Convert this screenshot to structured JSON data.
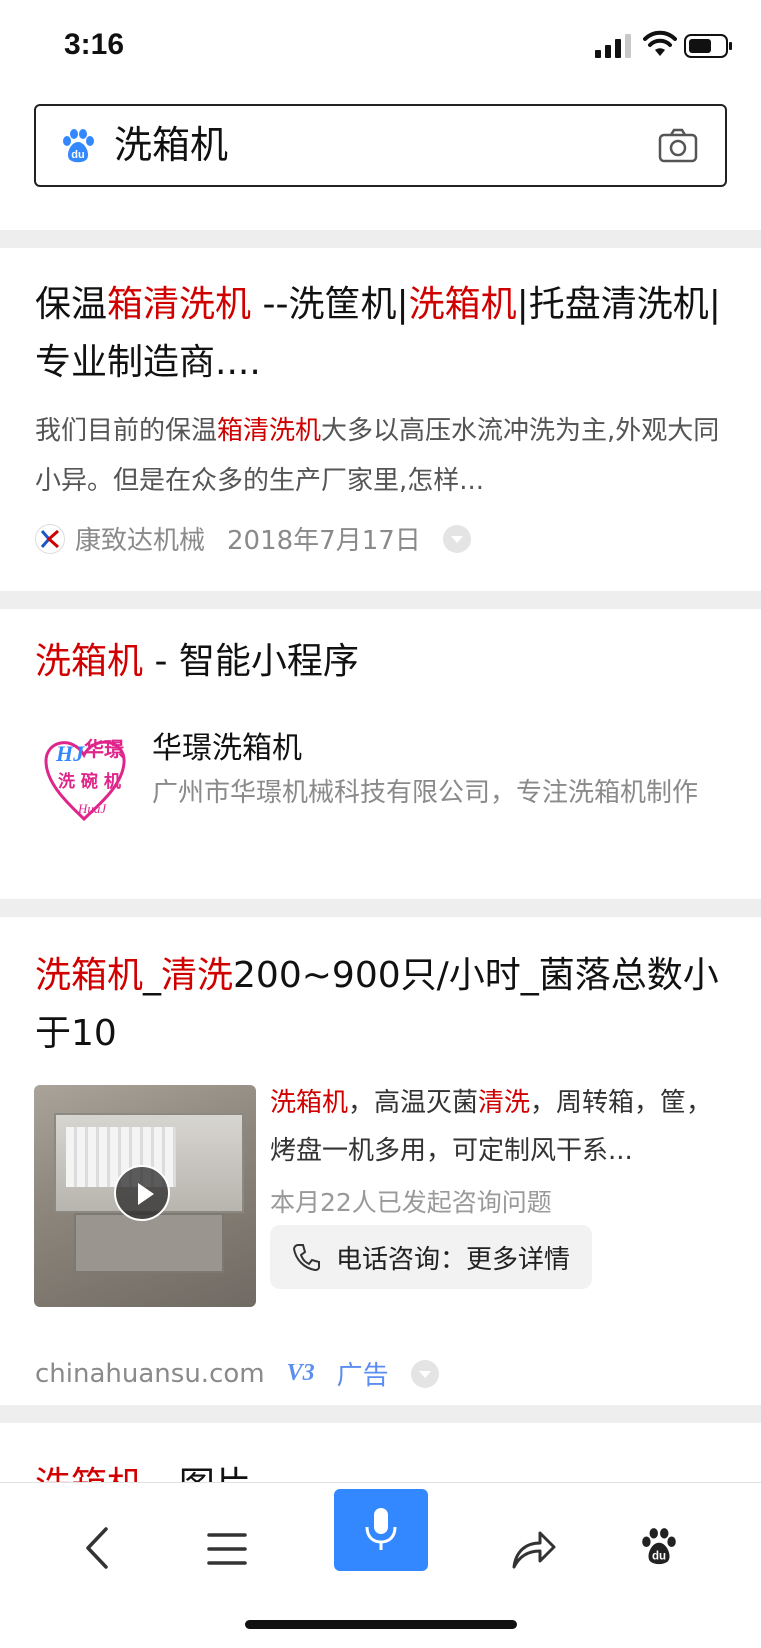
{
  "status": {
    "time": "3:16"
  },
  "search": {
    "query": "洗箱机"
  },
  "results": [
    {
      "title_parts": [
        {
          "t": "保温",
          "hl": false
        },
        {
          "t": "箱清洗机",
          "hl": true
        },
        {
          "t": " --洗筐机|",
          "hl": false
        },
        {
          "t": "洗箱机",
          "hl": true
        },
        {
          "t": "|托盘清洗机|专业制造商....",
          "hl": false
        }
      ],
      "abstract_parts": [
        {
          "t": "我们目前的保温",
          "hl": false
        },
        {
          "t": "箱清洗机",
          "hl": true
        },
        {
          "t": "大多以高压水流冲洗为主,外观大同小异。但是在众多的生产厂家里,怎样...",
          "hl": false
        }
      ],
      "source": "康致达机械",
      "date": "2018年7月17日"
    },
    {
      "title_hl": "洗箱机",
      "title_rest": " - 智能小程序",
      "app_name": "华璟洗箱机",
      "app_desc": "广州市华璟机械科技有限公司，专注洗箱机制作",
      "logo_text_1": "华璟",
      "logo_text_2": "洗 碗 机",
      "logo_sig": "HuaJ"
    },
    {
      "title_parts": [
        {
          "t": "洗箱机",
          "hl": true
        },
        {
          "t": "_",
          "hl": false
        },
        {
          "t": "清洗",
          "hl": true
        },
        {
          "t": "200~900只/小时_菌落总数小于10",
          "hl": false
        }
      ],
      "desc_parts": [
        {
          "t": "洗箱机",
          "hl": true
        },
        {
          "t": "，高温灭菌",
          "hl": false
        },
        {
          "t": "清洗",
          "hl": true
        },
        {
          "t": "，周转箱，筐，烤盘一机多用，可定制风干系...",
          "hl": false
        }
      ],
      "consult_count": "本月22人已发起咨询问题",
      "phone_label": "电话咨询：更多详情",
      "domain": "chinahuansu.com",
      "v_badge": "V3",
      "ad_label": "广告"
    },
    {
      "title_hl": "洗箱机",
      "title_rest": " - 图片"
    }
  ],
  "colors": {
    "highlight": "#d00000",
    "brand_blue": "#3388ff",
    "ad_blue": "#5b8ef0"
  }
}
